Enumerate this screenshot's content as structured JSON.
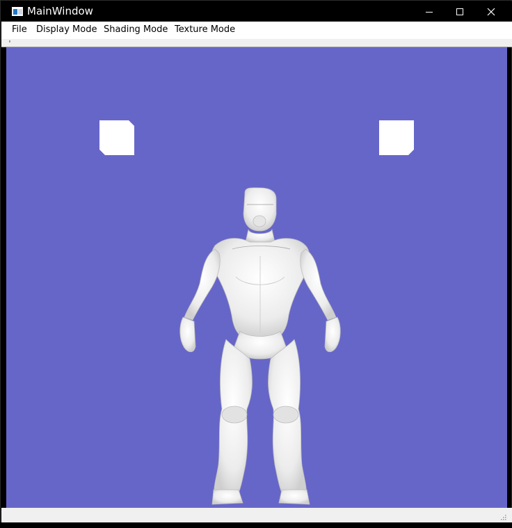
{
  "window": {
    "title": "MainWindow",
    "app_icon": "application-window-icon",
    "controls": [
      "minimize-icon",
      "maximize-icon",
      "close-icon"
    ]
  },
  "menu": {
    "file": "File",
    "display_mode": "Display Mode",
    "shading_mode": "Shading Mode",
    "texture_mode": "Texture Mode"
  },
  "viewport": {
    "background_color": "#6666c9",
    "model_color": "#f2f2f2",
    "content": "white shaded 3D humanoid figure with two light markers"
  }
}
